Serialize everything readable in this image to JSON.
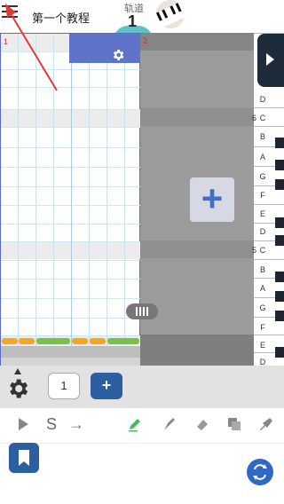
{
  "header": {
    "title": "第一个教程",
    "track_label": "轨道",
    "track_number": "1"
  },
  "grid": {
    "measures": [
      "1",
      "2"
    ]
  },
  "piano": {
    "keys": [
      "D",
      "C",
      "B",
      "A",
      "G",
      "F",
      "E",
      "D",
      "C",
      "B",
      "A",
      "G",
      "F",
      "E",
      "D"
    ],
    "octave_labels": [
      {
        "row": 1,
        "label": "6"
      },
      {
        "row": 8,
        "label": "5"
      }
    ]
  },
  "toolbar": {
    "track_count": "1",
    "add_label": "+"
  },
  "tools": [
    {
      "name": "play-tool",
      "glyph": "▶"
    },
    {
      "name": "snap-tool",
      "glyph": "S"
    },
    {
      "name": "arrow-tool",
      "glyph": "→"
    },
    {
      "name": "pencil-tool",
      "glyph": "✎"
    },
    {
      "name": "brush-tool",
      "glyph": "✐"
    },
    {
      "name": "eraser-tool",
      "glyph": "⌫"
    },
    {
      "name": "copy-tool",
      "glyph": "❐"
    },
    {
      "name": "paste-tool",
      "glyph": "✓"
    }
  ],
  "colors": {
    "accent": "#2b5fa0",
    "gear_block": "#5f73c9",
    "note_orange": "#f5a623",
    "note_green": "#7ac143",
    "arrow": "#e53935",
    "pencil_active": "#3fbf5f"
  }
}
